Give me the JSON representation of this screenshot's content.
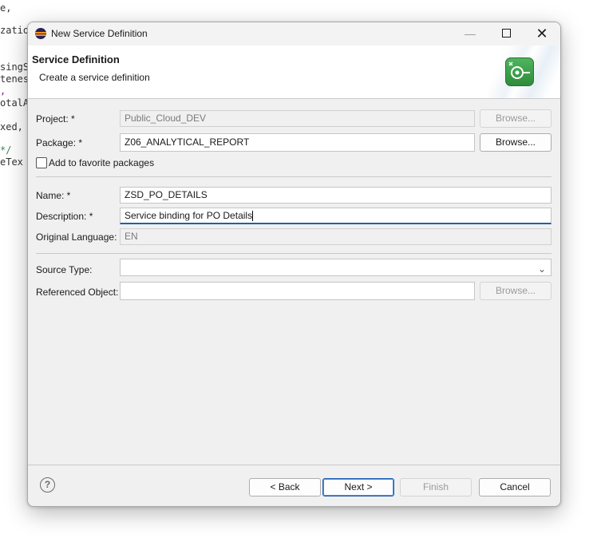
{
  "background_code": [
    "e,",
    "zatio",
    "singS",
    "tenes",
    ",",
    "otalA",
    "xed,",
    "*/",
    "eTex"
  ],
  "window": {
    "title": "New Service Definition",
    "controls": {
      "minimize": "—",
      "close": "✕"
    }
  },
  "header": {
    "title": "Service Definition",
    "subtitle": "Create a service definition"
  },
  "form": {
    "project": {
      "label": "Project: *",
      "value": "Public_Cloud_DEV",
      "button": "Browse..."
    },
    "package": {
      "label": "Package: *",
      "value": "Z06_ANALYTICAL_REPORT",
      "button": "Browse..."
    },
    "favorite": {
      "label": "Add to favorite packages",
      "checked": false
    },
    "name": {
      "label": "Name: *",
      "value": "ZSD_PO_DETAILS"
    },
    "description": {
      "label": "Description: *",
      "value": "Service binding for PO Details"
    },
    "original_language": {
      "label": "Original Language:",
      "value": "EN"
    },
    "source_type": {
      "label": "Source Type:",
      "value": ""
    },
    "referenced_object": {
      "label": "Referenced Object:",
      "value": "",
      "button": "Browse..."
    }
  },
  "footer": {
    "help": "?",
    "back": "< Back",
    "next": "Next >",
    "finish": "Finish",
    "cancel": "Cancel"
  },
  "colors": {
    "focus_accent": "#1f5fb5",
    "dialog_bg": "#f0f0f0",
    "icon_green": "#3a9e48"
  }
}
